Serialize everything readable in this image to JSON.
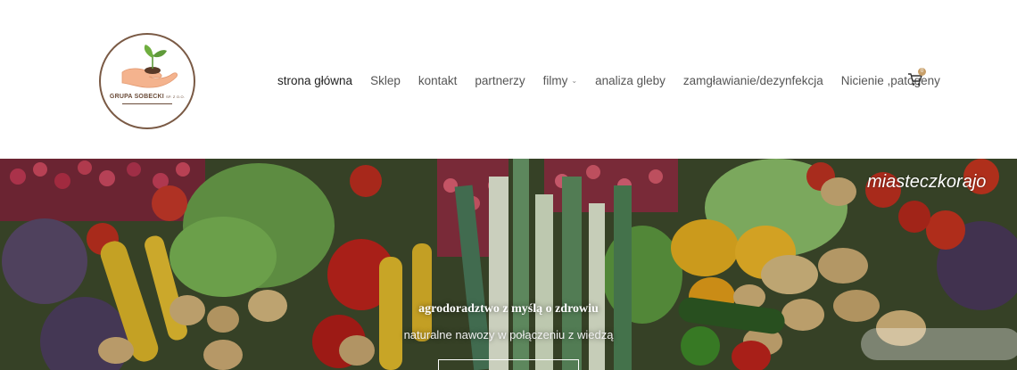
{
  "brand": {
    "logo_text": "GRUPA SOBECKI",
    "logo_suffix": "SP. Z O.O."
  },
  "nav": {
    "items": [
      {
        "label": "strona główna"
      },
      {
        "label": "Sklep"
      },
      {
        "label": "kontakt"
      },
      {
        "label": "partnerzy"
      },
      {
        "label": "filmy"
      },
      {
        "label": "analiza gleby"
      },
      {
        "label": "zamgławianie/dezynfekcja"
      },
      {
        "label": "Nicienie ,patogeny"
      }
    ],
    "cart_count": "0"
  },
  "hero": {
    "title": "agrodoradztwo z myślą o zdrowiu",
    "subtitle": "naturalne nawozy w połączeniu z wiedzą",
    "button_label": ""
  },
  "watermark": {
    "text": "miasteczkorajo"
  },
  "colors": {
    "accent": "#c8a06a",
    "logo_brown": "#7a5a45",
    "leaf_green": "#5f9a3a"
  },
  "icons": {
    "cart": "shopping-cart-icon",
    "dropdown": "chevron-down-icon",
    "logo": "hand-sprout-logo"
  }
}
